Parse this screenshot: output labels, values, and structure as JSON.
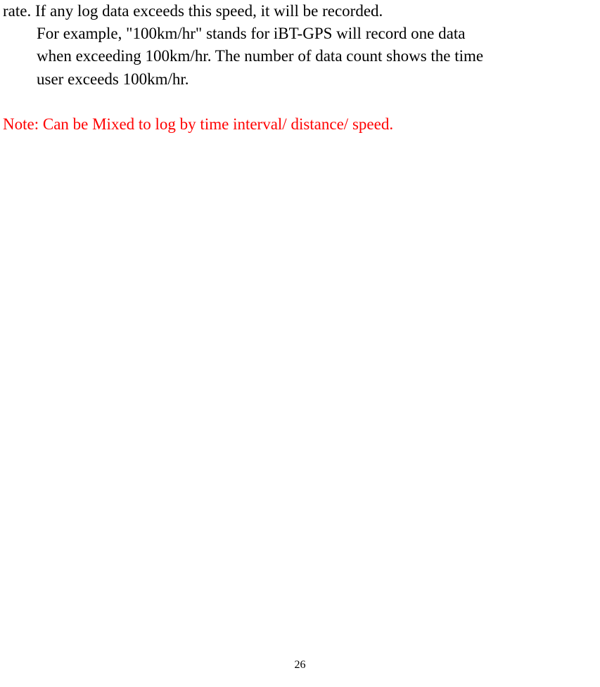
{
  "paragraph1": {
    "line1": "rate. If any log data exceeds this speed, it will be recorded.",
    "line2": "For example, \"100km/hr\" stands for iBT-GPS will record one data",
    "line3": "when exceeding 100km/hr. The number of data count shows the time",
    "line4": "user exceeds 100km/hr."
  },
  "note": "Note: Can be Mixed to log by time interval/ distance/ speed.",
  "pageNumber": "26"
}
